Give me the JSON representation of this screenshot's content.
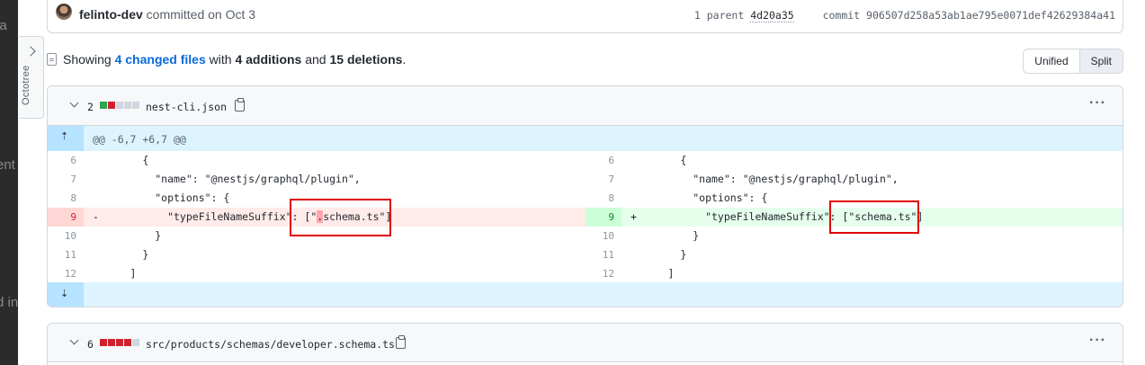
{
  "background": {
    "fragments": [
      "la",
      "ent",
      "d in"
    ]
  },
  "octotree": {
    "label": "Octotree"
  },
  "commit": {
    "author": "felinto-dev",
    "action": "committed on Oct 3",
    "parent_label": "1 parent",
    "parent_hash": "4d20a35",
    "commit_label": "commit",
    "commit_hash": "906507d258a53ab1ae795e0071def42629384a41"
  },
  "summary": {
    "prefix": "Showing",
    "changed": "4 changed files",
    "with": "with",
    "additions": "4 additions",
    "and": "and",
    "deletions": "15 deletions",
    "end": "."
  },
  "view_toggle": {
    "unified": "Unified",
    "split": "Split"
  },
  "file1": {
    "count": "2",
    "name": "nest-cli.json",
    "hunk": "@@ -6,7 +6,7 @@",
    "left": [
      {
        "ln": "6",
        "code": "        {"
      },
      {
        "ln": "7",
        "code": "          \"name\": \"@nestjs/graphql/plugin\","
      },
      {
        "ln": "8",
        "code": "          \"options\": {"
      },
      {
        "ln": "9",
        "marker": "-",
        "code_pre": "            \"typeFileNameSuffix\": [\"",
        "code_hl": ".",
        "code_post": "schema.ts\"]"
      },
      {
        "ln": "10",
        "code": "          }"
      },
      {
        "ln": "11",
        "code": "        }"
      },
      {
        "ln": "12",
        "code": "      ]"
      }
    ],
    "right": [
      {
        "ln": "6",
        "code": "        {"
      },
      {
        "ln": "7",
        "code": "          \"name\": \"@nestjs/graphql/plugin\","
      },
      {
        "ln": "8",
        "code": "          \"options\": {"
      },
      {
        "ln": "9",
        "marker": "+",
        "code": "            \"typeFileNameSuffix\": [\"schema.ts\"]"
      },
      {
        "ln": "10",
        "code": "          }"
      },
      {
        "ln": "11",
        "code": "        }"
      },
      {
        "ln": "12",
        "code": "      ]"
      }
    ]
  },
  "file2": {
    "count": "6",
    "name": "src/products/schemas/developer.schema.ts"
  },
  "icons": [
    "chevron-right-icon",
    "file-diff-icon",
    "chevron-down-icon",
    "clipboard-icon",
    "kebab-icon",
    "expand-up-icon",
    "expand-down-icon"
  ]
}
